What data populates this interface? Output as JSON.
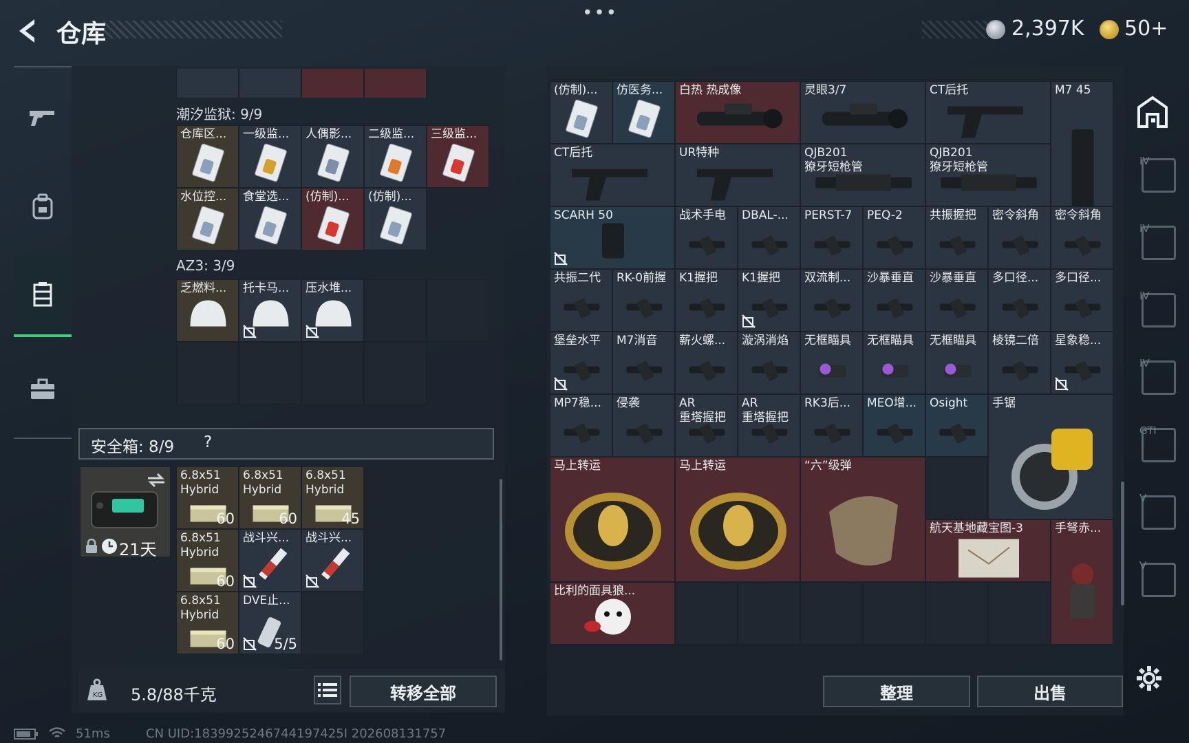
{
  "header": {
    "title": "仓库",
    "more": "•••",
    "currency_silver": "2,397K",
    "currency_gold": "50+"
  },
  "sidebar": {
    "items": [
      "weapons",
      "backpack",
      "storage",
      "briefcase"
    ]
  },
  "left_panel": {
    "section1_title": "潮汐监狱: 9/9",
    "section1_items": [
      {
        "label": "仓库区...",
        "style": "gold",
        "card": "#8aa0b8"
      },
      {
        "label": "一级监...",
        "style": "normal",
        "card": "#d4a22a"
      },
      {
        "label": "人偶影...",
        "style": "normal",
        "card": "#7f8fa8"
      },
      {
        "label": "二级监...",
        "style": "normal",
        "card": "#de7a2a"
      },
      {
        "label": "三级监...",
        "style": "red",
        "card": "#d8392e"
      },
      {
        "label": "水位控...",
        "style": "gold",
        "card": "#8aa0b8"
      },
      {
        "label": "食堂选...",
        "style": "normal",
        "card": "#8aa0b8"
      },
      {
        "label": "(仿制)...",
        "style": "red",
        "card": "#d8392e"
      },
      {
        "label": "(仿制)...",
        "style": "normal",
        "card": "#8aa0b8"
      }
    ],
    "section2_title": "AZ3: 3/9",
    "section2_items": [
      {
        "label": "乏燃料...",
        "style": "gold",
        "lock": false
      },
      {
        "label": "托卡马...",
        "style": "normal",
        "lock": true
      },
      {
        "label": "压水堆...",
        "style": "normal",
        "lock": true
      }
    ],
    "safe_title": "安全箱: 8/9",
    "safe_help": "?",
    "safebox_time": "21天",
    "safe_items": [
      {
        "label": "6.8x51\nHybrid",
        "qty": "60",
        "kind": "ammo"
      },
      {
        "label": "6.8x51\nHybrid",
        "qty": "60",
        "kind": "ammo"
      },
      {
        "label": "6.8x51\nHybrid",
        "qty": "45",
        "kind": "ammo"
      },
      {
        "label": "6.8x51\nHybrid",
        "qty": "60",
        "kind": "ammo"
      },
      {
        "label": "战斗兴...",
        "qty": "",
        "kind": "syringe",
        "lock": true
      },
      {
        "label": "战斗兴...",
        "qty": "",
        "kind": "syringe",
        "lock": true
      },
      {
        "label": "6.8x51\nHybrid",
        "qty": "60",
        "kind": "ammo"
      },
      {
        "label": "DVE止...",
        "qty": "5/5",
        "kind": "spray",
        "lock": true
      }
    ],
    "weight": "5.8/88千克",
    "transfer_all": "转移全部"
  },
  "right_panel": {
    "items": [
      {
        "label": "(仿制)...",
        "c": 0,
        "r": 0,
        "w": 1,
        "h": 1,
        "style": "normal",
        "kind": "card"
      },
      {
        "label": "仿医务...",
        "c": 1,
        "r": 0,
        "w": 1,
        "h": 1,
        "style": "blue",
        "kind": "card"
      },
      {
        "label": "白热 热成像",
        "c": 2,
        "r": 0,
        "w": 2,
        "h": 1,
        "style": "red",
        "kind": "scope"
      },
      {
        "label": "灵眼3/7",
        "c": 4,
        "r": 0,
        "w": 2,
        "h": 1,
        "style": "normal",
        "kind": "scope"
      },
      {
        "label": "CT后托",
        "c": 6,
        "r": 0,
        "w": 2,
        "h": 1,
        "style": "normal",
        "kind": "stock"
      },
      {
        "label": "M7 45",
        "c": 8,
        "r": 0,
        "w": 1,
        "h": 2,
        "style": "normal",
        "kind": "mag"
      },
      {
        "label": "CT后托",
        "c": 0,
        "r": 1,
        "w": 2,
        "h": 1,
        "style": "normal",
        "kind": "stock"
      },
      {
        "label": "UR特种",
        "c": 2,
        "r": 1,
        "w": 2,
        "h": 1,
        "style": "normal",
        "kind": "stock"
      },
      {
        "label": "QJB201\n獠牙短枪管",
        "c": 4,
        "r": 1,
        "w": 2,
        "h": 1,
        "style": "normal",
        "kind": "barrel"
      },
      {
        "label": "QJB201\n獠牙短枪管",
        "c": 6,
        "r": 1,
        "w": 2,
        "h": 1,
        "style": "normal",
        "kind": "barrel"
      },
      {
        "label": "SCARH 50",
        "c": 0,
        "r": 2,
        "w": 2,
        "h": 1,
        "style": "blue",
        "kind": "mag",
        "lock": true
      },
      {
        "label": "战术手电",
        "c": 2,
        "r": 2,
        "w": 1,
        "h": 1,
        "style": "normal",
        "kind": "small"
      },
      {
        "label": "DBAL-...",
        "c": 3,
        "r": 2,
        "w": 1,
        "h": 1,
        "style": "normal",
        "kind": "small"
      },
      {
        "label": "PERST-7",
        "c": 4,
        "r": 2,
        "w": 1,
        "h": 1,
        "style": "normal",
        "kind": "small"
      },
      {
        "label": "PEQ-2",
        "c": 5,
        "r": 2,
        "w": 1,
        "h": 1,
        "style": "normal",
        "kind": "small"
      },
      {
        "label": "共振握把",
        "c": 6,
        "r": 2,
        "w": 1,
        "h": 1,
        "style": "normal",
        "kind": "small"
      },
      {
        "label": "密令斜角",
        "c": 7,
        "r": 2,
        "w": 1,
        "h": 1,
        "style": "normal",
        "kind": "small"
      },
      {
        "label": "密令斜角",
        "c": 8,
        "r": 2,
        "w": 1,
        "h": 1,
        "style": "normal",
        "kind": "small"
      },
      {
        "label": "共振二代",
        "c": 0,
        "r": 3,
        "w": 1,
        "h": 1,
        "style": "normal",
        "kind": "small"
      },
      {
        "label": "RK-0前握",
        "c": 1,
        "r": 3,
        "w": 1,
        "h": 1,
        "style": "normal",
        "kind": "small"
      },
      {
        "label": "K1握把",
        "c": 2,
        "r": 3,
        "w": 1,
        "h": 1,
        "style": "normal",
        "kind": "small"
      },
      {
        "label": "K1握把",
        "c": 3,
        "r": 3,
        "w": 1,
        "h": 1,
        "style": "normal",
        "kind": "small",
        "lock": true
      },
      {
        "label": "双流制...",
        "c": 4,
        "r": 3,
        "w": 1,
        "h": 1,
        "style": "normal",
        "kind": "small"
      },
      {
        "label": "沙暴垂直",
        "c": 5,
        "r": 3,
        "w": 1,
        "h": 1,
        "style": "normal",
        "kind": "small"
      },
      {
        "label": "沙暴垂直",
        "c": 6,
        "r": 3,
        "w": 1,
        "h": 1,
        "style": "normal",
        "kind": "small"
      },
      {
        "label": "多口径...",
        "c": 7,
        "r": 3,
        "w": 1,
        "h": 1,
        "style": "normal",
        "kind": "small"
      },
      {
        "label": "多口径...",
        "c": 8,
        "r": 3,
        "w": 1,
        "h": 1,
        "style": "normal",
        "kind": "small"
      },
      {
        "label": "堡垒水平",
        "c": 0,
        "r": 4,
        "w": 1,
        "h": 1,
        "style": "normal",
        "kind": "small",
        "lock": true
      },
      {
        "label": "M7消音",
        "c": 1,
        "r": 4,
        "w": 1,
        "h": 1,
        "style": "normal",
        "kind": "small"
      },
      {
        "label": "薪火螺...",
        "c": 2,
        "r": 4,
        "w": 1,
        "h": 1,
        "style": "normal",
        "kind": "small"
      },
      {
        "label": "漩涡消焰",
        "c": 3,
        "r": 4,
        "w": 1,
        "h": 1,
        "style": "normal",
        "kind": "small"
      },
      {
        "label": "无框瞄具",
        "c": 4,
        "r": 4,
        "w": 1,
        "h": 1,
        "style": "normal",
        "kind": "sight"
      },
      {
        "label": "无框瞄具",
        "c": 5,
        "r": 4,
        "w": 1,
        "h": 1,
        "style": "normal",
        "kind": "sight"
      },
      {
        "label": "无框瞄具",
        "c": 6,
        "r": 4,
        "w": 1,
        "h": 1,
        "style": "normal",
        "kind": "sight"
      },
      {
        "label": "棱镜二倍",
        "c": 7,
        "r": 4,
        "w": 1,
        "h": 1,
        "style": "normal",
        "kind": "small"
      },
      {
        "label": "星象稳...",
        "c": 8,
        "r": 4,
        "w": 1,
        "h": 1,
        "style": "normal",
        "kind": "small",
        "lock": true
      },
      {
        "label": "MP7稳...",
        "c": 0,
        "r": 5,
        "w": 1,
        "h": 1,
        "style": "normal",
        "kind": "small"
      },
      {
        "label": "侵袭",
        "c": 1,
        "r": 5,
        "w": 1,
        "h": 1,
        "style": "normal",
        "kind": "small"
      },
      {
        "label": "AR\n重塔握把",
        "c": 2,
        "r": 5,
        "w": 1,
        "h": 1,
        "style": "normal",
        "kind": "small"
      },
      {
        "label": "AR\n重塔握把",
        "c": 3,
        "r": 5,
        "w": 1,
        "h": 1,
        "style": "normal",
        "kind": "small"
      },
      {
        "label": "RK3后...",
        "c": 4,
        "r": 5,
        "w": 1,
        "h": 1,
        "style": "normal",
        "kind": "small"
      },
      {
        "label": "MEO增...",
        "c": 5,
        "r": 5,
        "w": 1,
        "h": 1,
        "style": "blue",
        "kind": "small"
      },
      {
        "label": "Osight",
        "c": 6,
        "r": 5,
        "w": 1,
        "h": 1,
        "style": "blue",
        "kind": "small"
      },
      {
        "label": "手锯",
        "c": 7,
        "r": 5,
        "w": 2,
        "h": 2,
        "style": "normal",
        "kind": "saw"
      },
      {
        "label": "马上转运",
        "c": 0,
        "r": 6,
        "w": 2,
        "h": 2,
        "style": "red",
        "kind": "coin"
      },
      {
        "label": "马上转运",
        "c": 2,
        "r": 6,
        "w": 2,
        "h": 2,
        "style": "red",
        "kind": "coin"
      },
      {
        "label": "“六”级弹",
        "c": 4,
        "r": 6,
        "w": 2,
        "h": 2,
        "style": "red",
        "kind": "hand"
      },
      {
        "label": "航天基地藏宝图-3",
        "c": 6,
        "r": 7,
        "w": 2,
        "h": 1,
        "style": "red",
        "kind": "map"
      },
      {
        "label": "手弩赤...",
        "c": 8,
        "r": 7,
        "w": 1,
        "h": 2,
        "style": "red",
        "kind": "figure"
      },
      {
        "label": "比利的面具狼...",
        "c": 0,
        "r": 8,
        "w": 2,
        "h": 1,
        "style": "red",
        "kind": "doll"
      }
    ],
    "sort": "整理",
    "sell": "出售"
  },
  "right_sidebar": {
    "tags": [
      "IV",
      "IV",
      "IV",
      "IV",
      "GTI",
      "V",
      "V"
    ]
  },
  "footer": {
    "ping": "51ms",
    "uid": "CN UID:1839925246744197425I 202608131757"
  },
  "colors": {
    "accent_green": "#3bd27a",
    "red_cell": "#4f2a30",
    "gold_cell": "#3e3a2f"
  }
}
